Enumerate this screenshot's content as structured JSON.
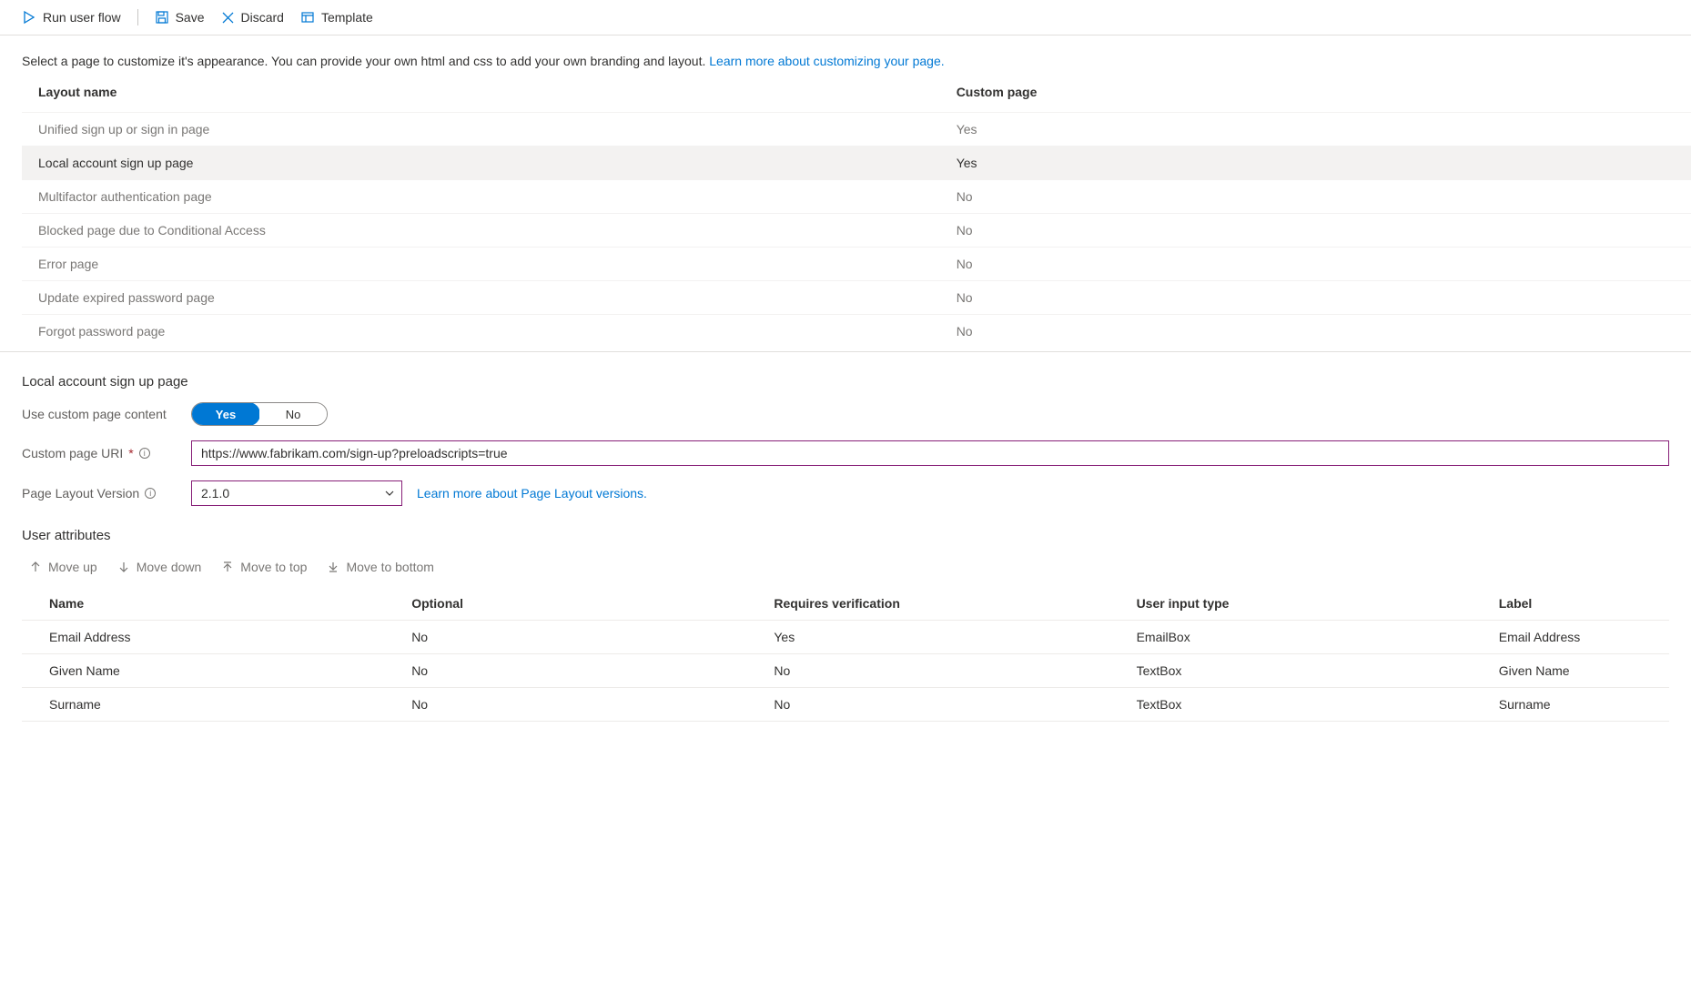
{
  "toolbar": {
    "run_label": "Run user flow",
    "save_label": "Save",
    "discard_label": "Discard",
    "template_label": "Template"
  },
  "description": {
    "text": "Select a page to customize it's appearance. You can provide your own html and css to add your own branding and layout. ",
    "link": "Learn more about customizing your page."
  },
  "layouts": {
    "headers": {
      "name": "Layout name",
      "custom": "Custom page"
    },
    "rows": [
      {
        "name": "Unified sign up or sign in page",
        "custom": "Yes",
        "selected": false
      },
      {
        "name": "Local account sign up page",
        "custom": "Yes",
        "selected": true
      },
      {
        "name": "Multifactor authentication page",
        "custom": "No",
        "selected": false
      },
      {
        "name": "Blocked page due to Conditional Access",
        "custom": "No",
        "selected": false
      },
      {
        "name": "Error page",
        "custom": "No",
        "selected": false
      },
      {
        "name": "Update expired password page",
        "custom": "No",
        "selected": false
      },
      {
        "name": "Forgot password page",
        "custom": "No",
        "selected": false
      }
    ]
  },
  "detail": {
    "title": "Local account sign up page",
    "use_custom_label": "Use custom page content",
    "toggle": {
      "yes": "Yes",
      "no": "No",
      "value": "Yes"
    },
    "uri_label": "Custom page URI",
    "uri_value": "https://www.fabrikam.com/sign-up?preloadscripts=true",
    "version_label": "Page Layout Version",
    "version_value": "2.1.0",
    "version_link": "Learn more about Page Layout versions."
  },
  "user_attributes": {
    "heading": "User attributes",
    "move": {
      "up": "Move up",
      "down": "Move down",
      "top": "Move to top",
      "bottom": "Move to bottom"
    },
    "headers": {
      "name": "Name",
      "optional": "Optional",
      "requires": "Requires verification",
      "input": "User input type",
      "label": "Label"
    },
    "rows": [
      {
        "name": "Email Address",
        "optional": "No",
        "requires": "Yes",
        "input": "EmailBox",
        "label": "Email Address"
      },
      {
        "name": "Given Name",
        "optional": "No",
        "requires": "No",
        "input": "TextBox",
        "label": "Given Name"
      },
      {
        "name": "Surname",
        "optional": "No",
        "requires": "No",
        "input": "TextBox",
        "label": "Surname"
      }
    ]
  }
}
